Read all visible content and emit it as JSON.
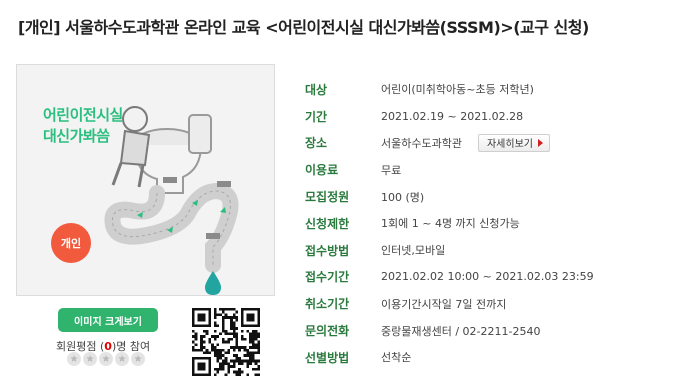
{
  "title": "[개인] 서울하수도과학관 온라인 교육 <어린이전시실 대신가봐씀(SSSM)>(교구 신청)",
  "poster": {
    "title_line1": "어린이전시실",
    "title_line2": "대신가봐씀",
    "badge": "개인"
  },
  "image_button": "이미지 크게보기",
  "rating": {
    "prefix": "회원평점 (",
    "count": "0",
    "suffix": ")명 참여",
    "stars": 0,
    "max_stars": 5
  },
  "info": [
    {
      "label": "대상",
      "value": "어린이(미취학아동~초등 저학년)"
    },
    {
      "label": "기간",
      "value": "2021.02.19 ~ 2021.02.28"
    },
    {
      "label": "장소",
      "value": "서울하수도과학관",
      "button": "자세히보기"
    },
    {
      "label": "이용료",
      "value": "무료"
    },
    {
      "label": "모집정원",
      "value": "100 (명)"
    },
    {
      "label": "신청제한",
      "value": "1회에 1 ~ 4명 까지 신청가능"
    },
    {
      "label": "접수방법",
      "value": "인터넷,모바일"
    },
    {
      "label": "접수기간",
      "value": "2021.02.02 10:00 ~ 2021.02.03 23:59"
    },
    {
      "label": "취소기간",
      "value": "이용기간시작일 7일 전까지"
    },
    {
      "label": "문의전화",
      "value": "중랑물재생센터 / 02-2211-2540"
    },
    {
      "label": "선별방법",
      "value": "선착순"
    }
  ],
  "colors": {
    "label": "#2a7a3e",
    "button": "#2fb36d",
    "badge": "#f15a3c",
    "poster_title": "#2bbf7f",
    "count": "#e00000"
  }
}
